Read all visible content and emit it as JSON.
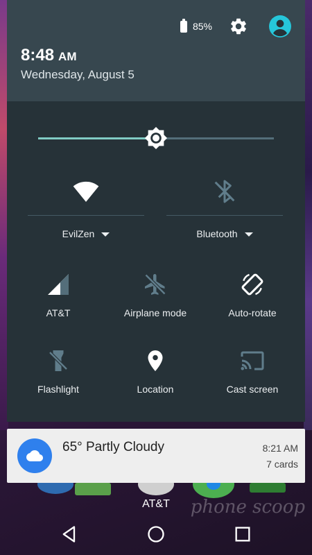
{
  "status": {
    "battery_percent": "85%",
    "battery_level": 0.85
  },
  "header": {
    "time": "8:48",
    "ampm": "AM",
    "date": "Wednesday, August 5"
  },
  "brightness": {
    "level": 0.5
  },
  "tiles_top": [
    {
      "label": "EvilZen",
      "icon": "wifi-icon",
      "state": "on"
    },
    {
      "label": "Bluetooth",
      "icon": "bluetooth-icon",
      "state": "off"
    }
  ],
  "tiles": [
    {
      "label": "AT&T",
      "icon": "signal-icon",
      "state": "on"
    },
    {
      "label": "Airplane mode",
      "icon": "airplane-icon",
      "state": "off"
    },
    {
      "label": "Auto-rotate",
      "icon": "auto-rotate-icon",
      "state": "on"
    },
    {
      "label": "Flashlight",
      "icon": "flashlight-icon",
      "state": "off"
    },
    {
      "label": "Location",
      "icon": "location-icon",
      "state": "on"
    },
    {
      "label": "Cast screen",
      "icon": "cast-icon",
      "state": "off"
    }
  ],
  "card": {
    "title": "65° Partly Cloudy",
    "time": "8:21 AM",
    "count": "7 cards",
    "icon": "cloud-icon"
  },
  "carrier_label": "AT&T",
  "watermark": "phone scoop",
  "colors": {
    "header_bg": "#37474f",
    "panel_bg": "#263238",
    "accent": "#80cbc4",
    "user_icon": "#26c6da",
    "weather_badge": "#2f80ed"
  }
}
